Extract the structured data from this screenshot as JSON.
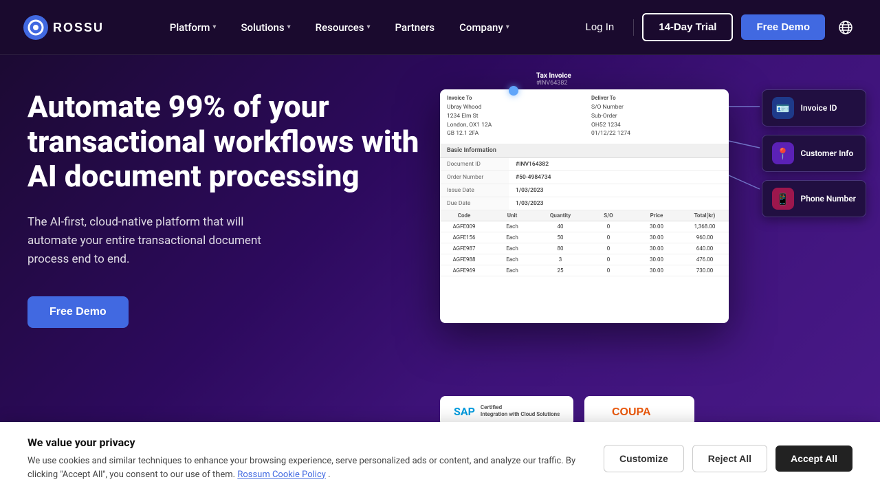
{
  "brand": {
    "name": "ROSSUM",
    "logo_text": "ROSSUM"
  },
  "navbar": {
    "links": [
      {
        "label": "Platform",
        "has_dropdown": true
      },
      {
        "label": "Solutions",
        "has_dropdown": true
      },
      {
        "label": "Resources",
        "has_dropdown": true
      },
      {
        "label": "Partners",
        "has_dropdown": false
      },
      {
        "label": "Company",
        "has_dropdown": true
      }
    ],
    "login_label": "Log In",
    "trial_label": "14-Day Trial",
    "demo_label": "Free Demo"
  },
  "hero": {
    "heading": "Automate 99% of your transactional workflows with AI document processing",
    "subtext": "The AI-first, cloud-native platform that will automate your entire transactional document process end to end.",
    "cta_label": "Free Demo"
  },
  "document": {
    "invoice_to_label": "Invoice To",
    "deliver_to_label": "Deliver To",
    "invoice_to_name": "Ubray Whood",
    "invoice_to_addr": "1234 Elm St\nLondon, OX1 12A\nGB 12.1 2FA",
    "deliver_to_addr": "S/O Number\nSub-Order\nOH52 1234\n01/12/22 1274",
    "section_title": "Basic Information",
    "fields": [
      {
        "label": "Document ID",
        "value": "#INV164382"
      },
      {
        "label": "Order Number",
        "value": "#50-4984734"
      },
      {
        "label": "Issue Date",
        "value": "1/03/2023"
      },
      {
        "label": "Due Date",
        "value": "1/03/2023"
      }
    ],
    "table_headers": [
      "Code",
      "Unit",
      "Quantity",
      "S/O",
      "Price",
      "Total(kr)"
    ],
    "table_rows": [
      [
        "AGFE009",
        "Each",
        "40",
        "0",
        "30.00",
        "1,368.00"
      ],
      [
        "AGFE156",
        "Each",
        "50",
        "0",
        "30.00",
        "960.00"
      ],
      [
        "AGFE987",
        "Each",
        "80",
        "0",
        "30.00",
        "640.00"
      ],
      [
        "AGFE988",
        "Each",
        "3",
        "0",
        "30.00",
        "476.00"
      ],
      [
        "AGFE969",
        "Each",
        "25",
        "0",
        "30.00",
        "730.00"
      ]
    ]
  },
  "floating_labels": [
    {
      "icon": "🪪",
      "text": "Invoice ID",
      "icon_bg": "blue"
    },
    {
      "icon": "📍",
      "text": "Customer Info",
      "icon_bg": "purple"
    },
    {
      "icon": "📱",
      "text": "Phone Number",
      "icon_bg": "pink"
    }
  ],
  "tax_invoice": {
    "label": "Tax Invoice",
    "number": "#INV64382"
  },
  "bottom_logos": [
    {
      "name": "SAP Certified",
      "sub": "Integration with Cloud Solutions"
    },
    {
      "name": "COUPA",
      "sub": ""
    }
  ],
  "cookie_banner": {
    "title": "We value your privacy",
    "body": "We use cookies and similar techniques to enhance your browsing experience, serve personalized ads or content, and analyze our traffic. By clicking \"Accept All\", you consent to our use of them.",
    "link_text": "Rossum Cookie Policy",
    "customize_label": "Customize",
    "reject_label": "Reject All",
    "accept_label": "Accept All"
  }
}
